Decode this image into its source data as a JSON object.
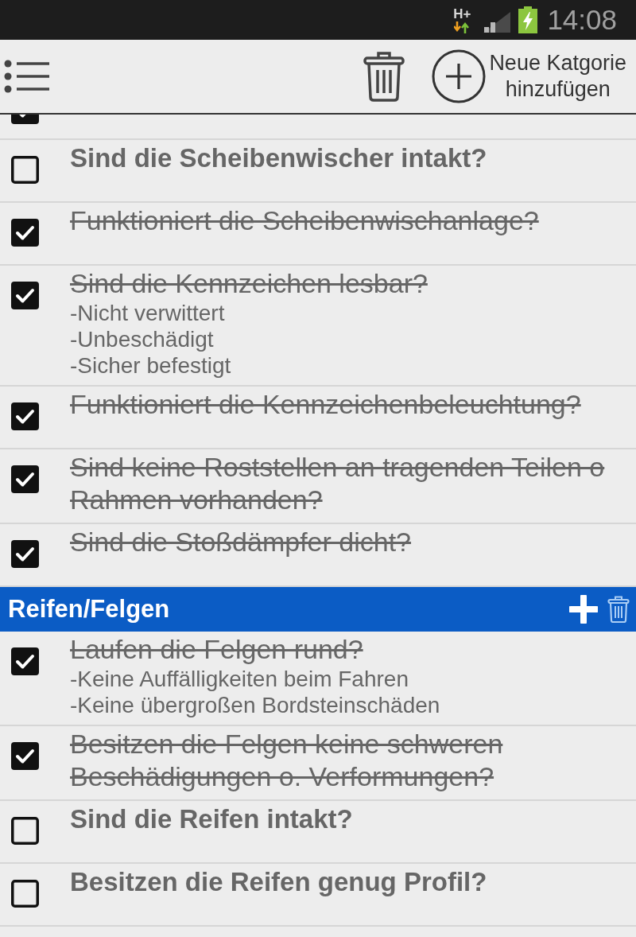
{
  "status_bar": {
    "network": "H+",
    "time": "14:08"
  },
  "toolbar": {
    "add_category": "Neue Katgorie\nhinzufügen"
  },
  "sections": [
    {
      "clipped_item": {
        "checked": true
      },
      "items": [
        {
          "title": "Sind die Scheibenwischer intakt?",
          "checked": false
        },
        {
          "title": "Funktioniert die Scheibenwischanlage?",
          "checked": true
        },
        {
          "title": "Sind die Kennzeichen lesbar?",
          "checked": true,
          "notes": [
            "-Nicht verwittert",
            "-Unbeschädigt",
            "-Sicher befestigt"
          ]
        },
        {
          "title": "Funktioniert die Kennzeichenbeleuchtung?",
          "checked": true
        },
        {
          "title": "Sind keine Roststellen an tragenden Teilen o\nRahmen vorhanden?",
          "checked": true
        },
        {
          "title": "Sind die Stoßdämpfer dicht?",
          "checked": true
        }
      ]
    },
    {
      "title": "Reifen/Felgen",
      "items": [
        {
          "title": "Laufen die Felgen rund?",
          "checked": true,
          "notes": [
            "-Keine Auffälligkeiten beim Fahren",
            "-Keine übergroßen Bordsteinschäden"
          ]
        },
        {
          "title": "Besitzen die Felgen keine schweren\nBeschädigungen o. Verformungen?",
          "checked": true
        },
        {
          "title": "Sind die Reifen intakt?",
          "checked": false
        },
        {
          "title": "Besitzen die Reifen genug Profil?",
          "checked": false
        }
      ]
    }
  ]
}
